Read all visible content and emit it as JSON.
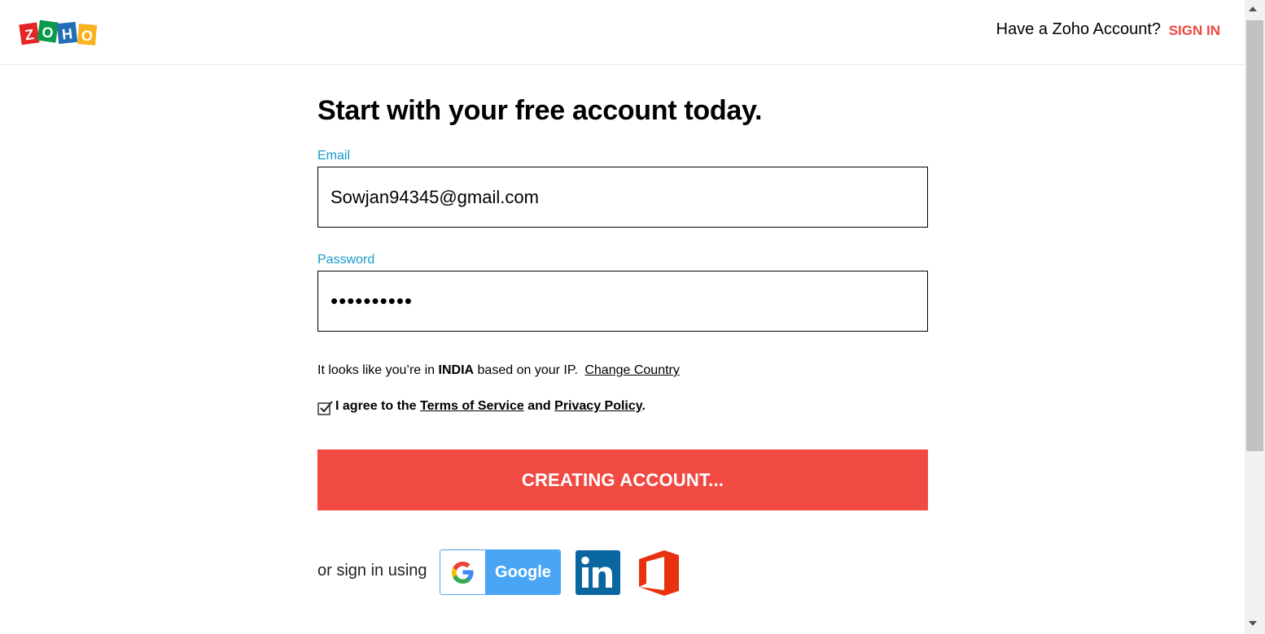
{
  "header": {
    "logo_alt": "ZOHO",
    "have_account_text": "Have a Zoho Account?",
    "signin_label": "SIGN IN"
  },
  "form": {
    "title": "Start with your free account today.",
    "email_label": "Email",
    "email_value": "Sowjan94345@gmail.com",
    "password_label": "Password",
    "password_value": "••••••••••",
    "ip_prefix": "It looks like you’re in",
    "country": "INDIA",
    "ip_suffix": "based on your IP.",
    "change_country": "Change Country",
    "agree_prefix": "I agree to the",
    "terms_label": "Terms of Service",
    "agree_and": "and",
    "privacy_label": "Privacy Policy",
    "agree_period": ".",
    "agree_checked": true,
    "submit_label": "CREATING ACCOUNT..."
  },
  "social": {
    "or_sign_in_text": "or sign in using",
    "google_label": "Google",
    "linkedin_icon": "linkedin-icon",
    "office_icon": "office365-icon"
  },
  "colors": {
    "accent_red": "#f04a42",
    "label_blue": "#159aca",
    "google_blue": "#4aa6f4",
    "linkedin_blue": "#0a66a0",
    "office_red": "#e8320f"
  }
}
